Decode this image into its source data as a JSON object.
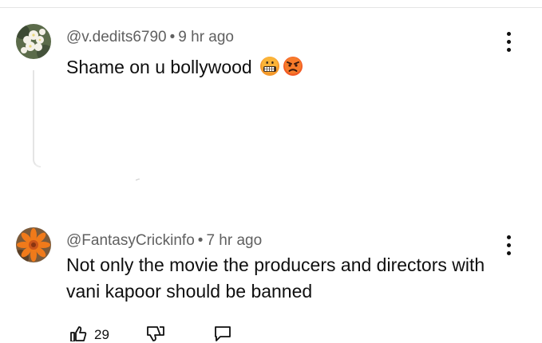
{
  "comments": [
    {
      "author": "@v.dedits6790",
      "separator": "•",
      "time": "9 hr ago",
      "text": "Shame on u bollywood",
      "emojis": [
        "grimacing-face-emoji",
        "angry-face-emoji"
      ],
      "avatar": "white-flowers-avatar"
    },
    {
      "author": "@FantasyCrickinfo",
      "separator": "•",
      "time": "7 hr ago",
      "text": "Not only the movie the producers and directors with vani kapoor should be banned",
      "avatar": "orange-flower-avatar",
      "actions": {
        "like_count": "29",
        "icons": [
          "thumbs-up-icon",
          "thumbs-down-icon",
          "reply-icon"
        ]
      }
    }
  ],
  "menu_icon": "more-vertical-icon"
}
